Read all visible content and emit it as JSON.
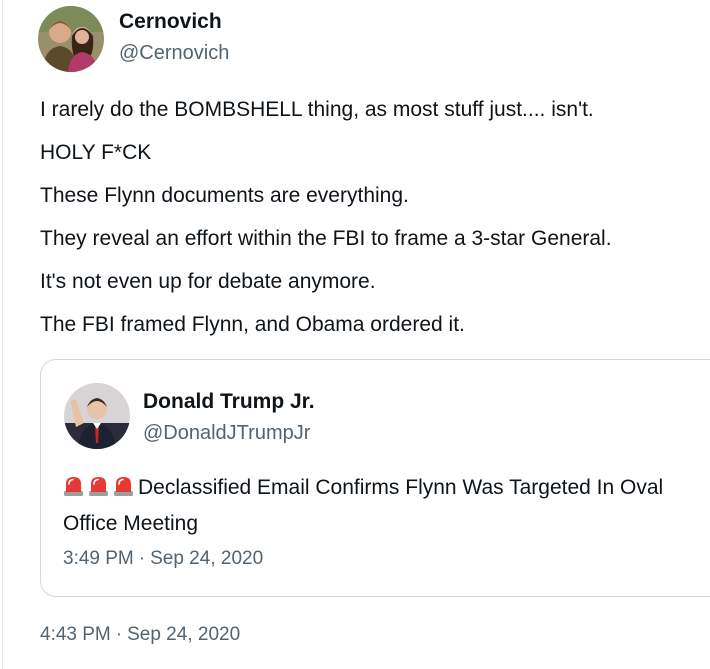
{
  "tweet": {
    "author_name": "Cernovich",
    "author_handle": "@Cernovich",
    "lines": [
      "I rarely do the BOMBSHELL thing, as most stuff just.... isn't.",
      "HOLY F*CK",
      "These Flynn documents are everything.",
      "They reveal an effort within the FBI to frame a 3-star General.",
      "It's not even up for debate anymore.",
      "The FBI framed Flynn, and Obama ordered it."
    ],
    "time": "4:43 PM",
    "separator": "·",
    "date": "Sep 24, 2020"
  },
  "quoted": {
    "author_name": "Donald Trump Jr.",
    "author_handle": "@DonaldJTrumpJr",
    "emoji": [
      "police-car-light-icon",
      "police-car-light-icon",
      "police-car-light-icon"
    ],
    "text": "Declassified Email Confirms Flynn Was Targeted In Oval Office Meeting",
    "time": "3:49 PM",
    "separator": "·",
    "date": "Sep 24, 2020"
  },
  "colors": {
    "text_primary": "#0f1419",
    "text_secondary": "#536471",
    "border": "#cfd9de",
    "siren_red": "#e53935"
  }
}
